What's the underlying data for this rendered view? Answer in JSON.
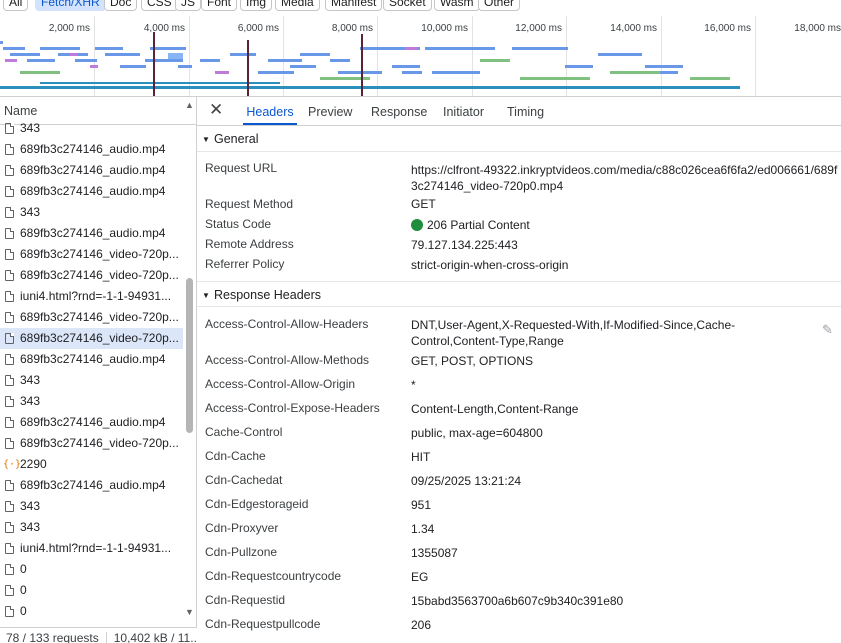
{
  "filters": [
    "All",
    "Fetch/XHR",
    "Doc",
    "CSS",
    "JS",
    "Font",
    "Img",
    "Media",
    "Manifest",
    "Socket",
    "Wasm",
    "Other"
  ],
  "filter_active": "Fetch/XHR",
  "overview": {
    "ticks": [
      "2,000 ms",
      "4,000 ms",
      "6,000 ms",
      "8,000 ms",
      "10,000 ms",
      "12,000 ms",
      "14,000 ms",
      "16,000 ms",
      "18,000 ms"
    ]
  },
  "list": {
    "header": "Name",
    "rows": [
      {
        "name": "343",
        "icon": "file-icon"
      },
      {
        "name": "689fb3c274146_audio.mp4",
        "icon": "file-icon"
      },
      {
        "name": "689fb3c274146_audio.mp4",
        "icon": "file-icon"
      },
      {
        "name": "689fb3c274146_audio.mp4",
        "icon": "file-icon"
      },
      {
        "name": "343",
        "icon": "file-icon"
      },
      {
        "name": "689fb3c274146_audio.mp4",
        "icon": "file-icon"
      },
      {
        "name": "689fb3c274146_video-720p...",
        "icon": "file-icon"
      },
      {
        "name": "689fb3c274146_video-720p...",
        "icon": "file-icon"
      },
      {
        "name": "iuni4.html?rnd=-1-1-94931...",
        "icon": "file-icon"
      },
      {
        "name": "689fb3c274146_video-720p...",
        "icon": "file-icon"
      },
      {
        "name": "689fb3c274146_video-720p...",
        "icon": "file-icon",
        "selected": true
      },
      {
        "name": "689fb3c274146_audio.mp4",
        "icon": "file-icon"
      },
      {
        "name": "343",
        "icon": "file-icon"
      },
      {
        "name": "343",
        "icon": "file-icon"
      },
      {
        "name": "689fb3c274146_audio.mp4",
        "icon": "file-icon"
      },
      {
        "name": "689fb3c274146_video-720p...",
        "icon": "file-icon"
      },
      {
        "name": "2290",
        "icon": "xhr-icon"
      },
      {
        "name": "689fb3c274146_audio.mp4",
        "icon": "file-icon"
      },
      {
        "name": "343",
        "icon": "file-icon"
      },
      {
        "name": "343",
        "icon": "file-icon"
      },
      {
        "name": "iuni4.html?rnd=-1-1-94931...",
        "icon": "file-icon"
      },
      {
        "name": "0",
        "icon": "file-icon"
      },
      {
        "name": "0",
        "icon": "file-icon"
      },
      {
        "name": "0",
        "icon": "file-icon"
      }
    ]
  },
  "status_bar": {
    "requests": "78 / 133 requests",
    "transferred": "10,402 kB / 11..."
  },
  "detail": {
    "tabs": [
      "Headers",
      "Preview",
      "Response",
      "Initiator",
      "Timing"
    ],
    "active_tab": "Headers",
    "general": {
      "title": "General",
      "rows": [
        {
          "key": "Request URL",
          "value": "https://clfront-49322.inkryptvideos.com/media/c88c026cea6f6fa2/ed006661/689f",
          "value2": "3c274146_video-720p0.mp4"
        },
        {
          "key": "Request Method",
          "value": "GET"
        },
        {
          "key": "Status Code",
          "value": "206 Partial Content"
        },
        {
          "key": "Remote Address",
          "value": "79.127.134.225:443"
        },
        {
          "key": "Referrer Policy",
          "value": "strict-origin-when-cross-origin"
        }
      ]
    },
    "response_headers": {
      "title": "Response Headers",
      "rows": [
        {
          "key": "Access-Control-Allow-Headers",
          "value": "DNT,User-Agent,X-Requested-With,If-Modified-Since,Cache-",
          "value2": "Control,Content-Type,Range"
        },
        {
          "key": "Access-Control-Allow-Methods",
          "value": "GET, POST, OPTIONS"
        },
        {
          "key": "Access-Control-Allow-Origin",
          "value": "*"
        },
        {
          "key": "Access-Control-Expose-Headers",
          "value": "Content-Length,Content-Range"
        },
        {
          "key": "Cache-Control",
          "value": "public, max-age=604800"
        },
        {
          "key": "Cdn-Cache",
          "value": "HIT"
        },
        {
          "key": "Cdn-Cachedat",
          "value": "09/25/2025 13:21:24"
        },
        {
          "key": "Cdn-Edgestorageid",
          "value": "951"
        },
        {
          "key": "Cdn-Proxyver",
          "value": "1.34"
        },
        {
          "key": "Cdn-Pullzone",
          "value": "1355087"
        },
        {
          "key": "Cdn-Requestcountrycode",
          "value": "EG"
        },
        {
          "key": "Cdn-Requestid",
          "value": "15babd3563700a6b607c9b340c391e80"
        },
        {
          "key": "Cdn-Requestpullcode",
          "value": "206"
        }
      ]
    }
  }
}
